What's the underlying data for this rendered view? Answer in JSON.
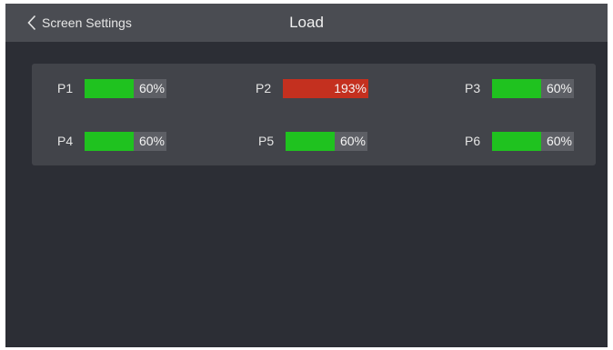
{
  "header": {
    "back_label": "Screen Settings",
    "title": "Load"
  },
  "ports": [
    {
      "label": "P1",
      "value": "60%",
      "percent": 60,
      "status_color": "#1fc21f"
    },
    {
      "label": "P2",
      "value": "193%",
      "percent": 193,
      "status_color": "#c4301f"
    },
    {
      "label": "P3",
      "value": "60%",
      "percent": 60,
      "status_color": "#1fc21f"
    },
    {
      "label": "P4",
      "value": "60%",
      "percent": 60,
      "status_color": "#1fc21f"
    },
    {
      "label": "P5",
      "value": "60%",
      "percent": 60,
      "status_color": "#1fc21f"
    },
    {
      "label": "P6",
      "value": "60%",
      "percent": 60,
      "status_color": "#1fc21f"
    }
  ]
}
